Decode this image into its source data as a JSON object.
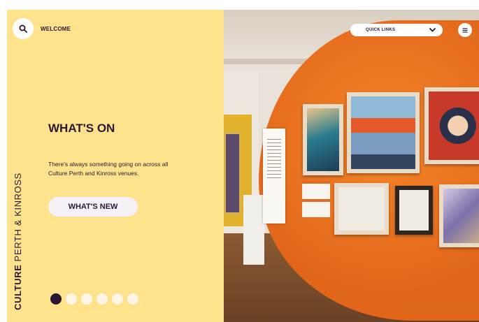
{
  "header": {
    "welcome_label": "WELCOME",
    "quick_links_label": "QUICK LINKS"
  },
  "hero": {
    "headline": "WHAT'S ON",
    "description": "There's always something going on across all Culture Perth and Kinross venues.",
    "cta_label": "WHAT'S NEW"
  },
  "brand": {
    "part1": "CULTURE",
    "part2": "PERTH & KINROSS"
  },
  "carousel": {
    "total_slides": 6,
    "active_slide": 1
  },
  "icons": {
    "search": "search-icon",
    "quick_links_chevron": "chevron-down-icon",
    "menu": "hamburger-menu-icon"
  },
  "colors": {
    "panel_background": "#ffe28c",
    "accent_dark": "#2a1733",
    "button_light": "#f5f1f6",
    "dot_inactive": "#fff6e8"
  }
}
